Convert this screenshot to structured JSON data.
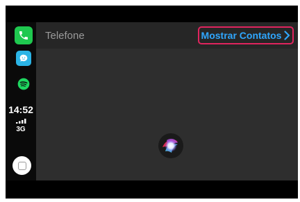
{
  "sidebar": {
    "apps": [
      {
        "name": "phone",
        "icon": "phone-icon",
        "color": "#1fc84f"
      },
      {
        "name": "waze",
        "icon": "waze-icon",
        "color": "#2bb4e6"
      },
      {
        "name": "spotify",
        "icon": "spotify-icon",
        "color": "#1ed760"
      }
    ],
    "time": "14:52",
    "network": "3G"
  },
  "header": {
    "title": "Telefone",
    "contacts_button_label": "Mostrar Contatos",
    "contacts_button_color": "#2fa7ff",
    "highlight_color": "#e0245e"
  },
  "siri": {
    "icon": "siri-orb-icon"
  }
}
